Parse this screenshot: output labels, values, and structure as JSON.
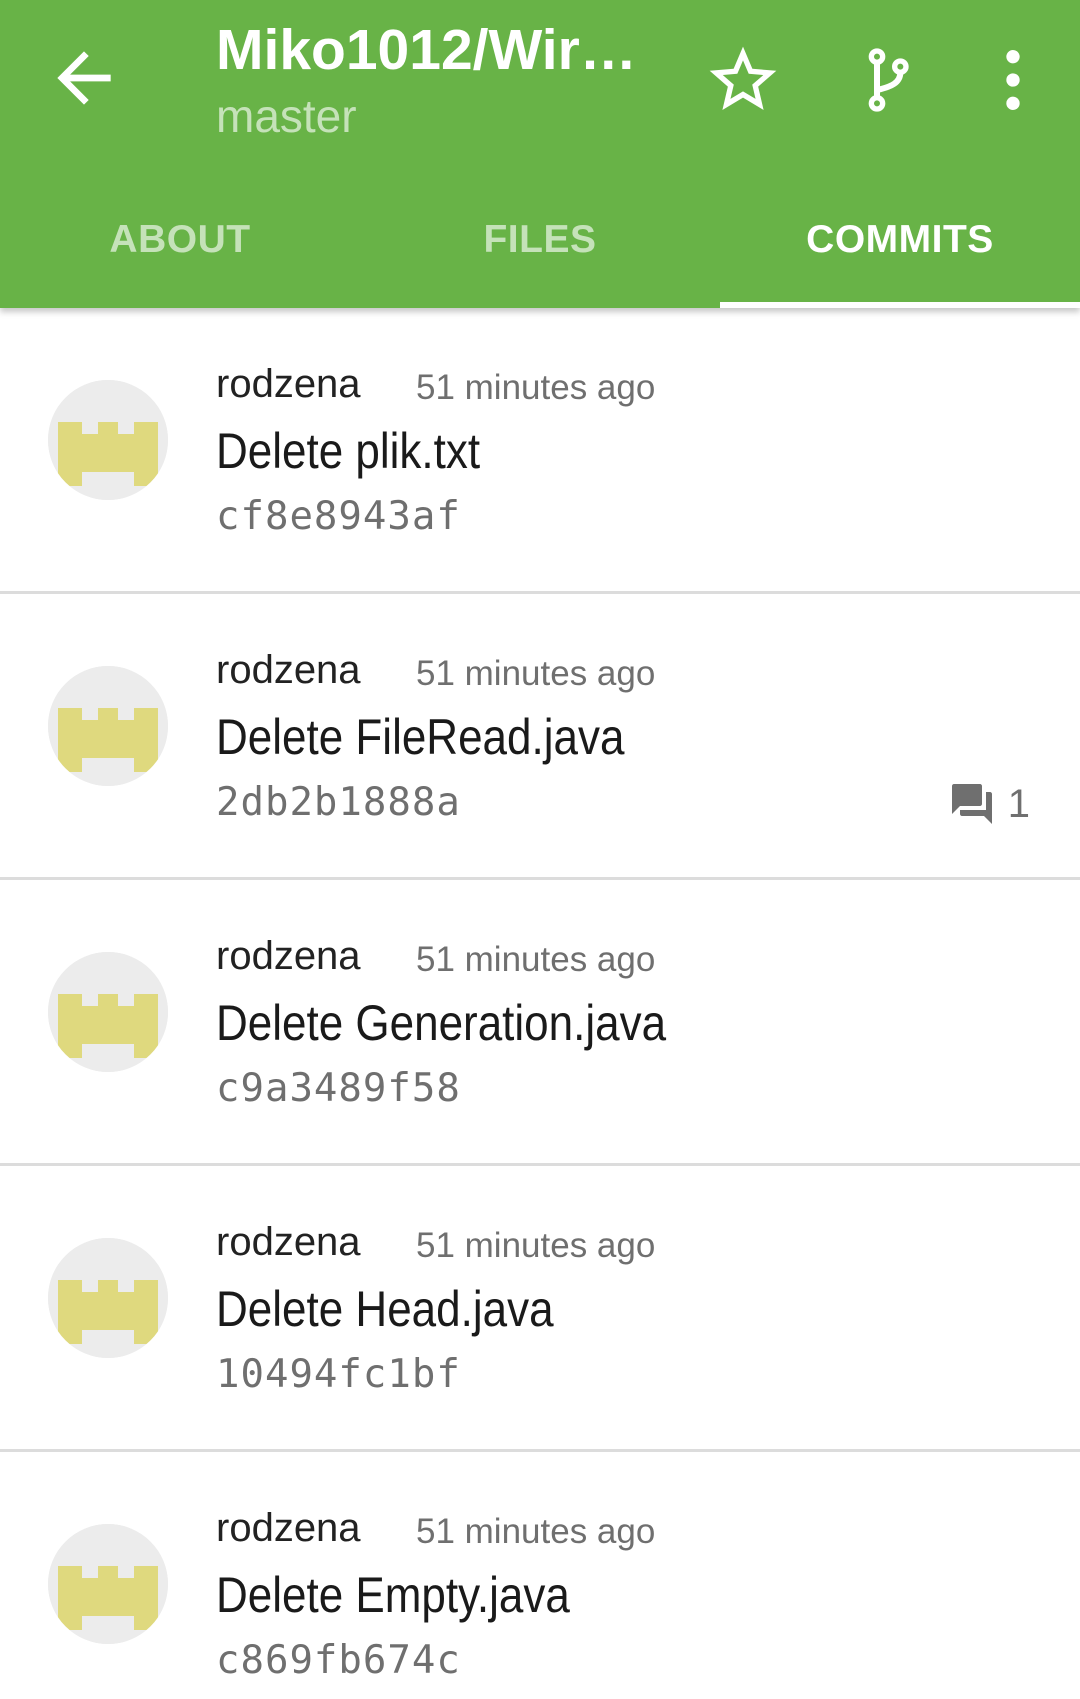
{
  "toolbar": {
    "title": "Miko1012/Wir…",
    "branch": "master",
    "back_icon": "arrow-back-icon",
    "star_icon": "star-outline-icon",
    "branch_icon": "git-branch-icon",
    "more_icon": "more-vert-icon"
  },
  "tabs": [
    {
      "label": "ABOUT",
      "active": false
    },
    {
      "label": "FILES",
      "active": false
    },
    {
      "label": "COMMITS",
      "active": true
    }
  ],
  "colors": {
    "appbar": "#68b347",
    "avatar_fill": "#dfd97e",
    "avatar_bg": "#ececec"
  },
  "commits": [
    {
      "author": "rodzena",
      "time": "51 minutes ago",
      "message": "Delete plik.txt",
      "sha": "cf8e8943af",
      "comments": ""
    },
    {
      "author": "rodzena",
      "time": "51 minutes ago",
      "message": "Delete FileRead.java",
      "sha": "2db2b1888a",
      "comments": "1"
    },
    {
      "author": "rodzena",
      "time": "51 minutes ago",
      "message": "Delete Generation.java",
      "sha": "c9a3489f58",
      "comments": ""
    },
    {
      "author": "rodzena",
      "time": "51 minutes ago",
      "message": "Delete Head.java",
      "sha": "10494fc1bf",
      "comments": ""
    },
    {
      "author": "rodzena",
      "time": "51 minutes ago",
      "message": "Delete Empty.java",
      "sha": "c869fb674c",
      "comments": ""
    }
  ]
}
